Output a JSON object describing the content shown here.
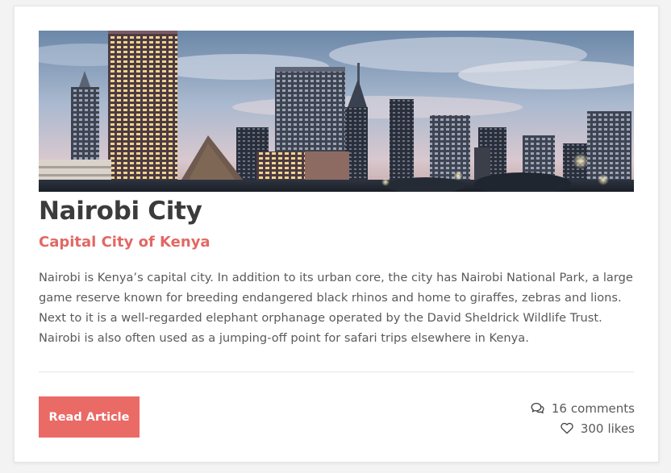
{
  "article": {
    "title": "Nairobi City",
    "subtitle": "Capital City of Kenya",
    "body": "Nairobi is Kenya’s capital city. In addition to its urban core, the city has Nairobi National Park, a large game reserve known for breeding endangered black rhinos and home to giraffes, zebras and lions. Next to it is a well-regarded elephant orphanage operated by the David Sheldrick Wildlife Trust. Nairobi is also often used as a jumping-off point for safari trips elsewhere in Kenya.",
    "image_icon": "city-skyline-photo"
  },
  "actions": {
    "read_label": "Read Article"
  },
  "stats": {
    "comments_count": "16",
    "comments_label": "comments",
    "comments_icon": "comments-icon",
    "likes_count": "300",
    "likes_label": "likes",
    "likes_icon": "heart-icon"
  },
  "colors": {
    "accent": "#ea6a66",
    "subtitle": "#e26863",
    "title": "#3b3b3b",
    "body_text": "#5a5a5a",
    "card_bg": "#ffffff",
    "page_bg": "#f3f3f3"
  }
}
